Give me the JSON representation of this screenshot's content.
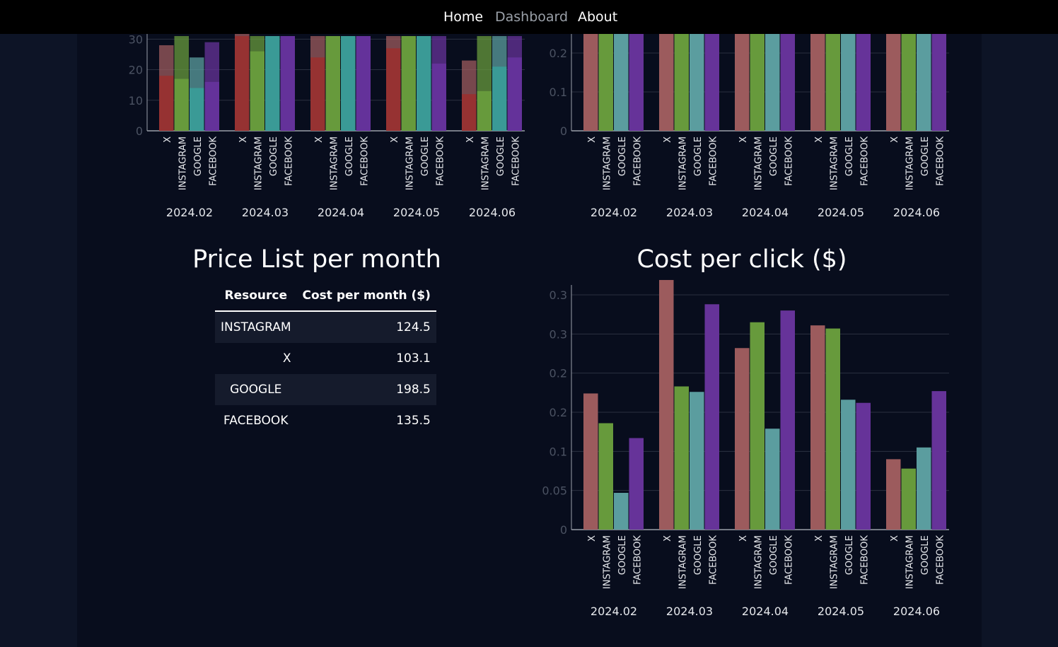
{
  "nav": {
    "home": "Home",
    "dashboard": "Dashboard",
    "about": "About"
  },
  "colors": {
    "X": "#9c5b5d",
    "INSTAGRAM": "#679a3c",
    "GOOGLE": "#5b9d9f",
    "FACEBOOK": "#663399",
    "X_dark": "#963232",
    "INSTAGRAM_dark": "#679a3c",
    "GOOGLE_dark": "#3a9a96",
    "FACEBOOK_dark": "#64329a",
    "grid": "#2a3040",
    "axis_text": "#4b5262"
  },
  "price_list": {
    "title": "Price List per month",
    "headers": [
      "Resource",
      "Cost per month ($)"
    ],
    "rows": [
      {
        "resource": "INSTAGRAM",
        "cost": "124.5"
      },
      {
        "resource": "X",
        "cost": "103.1"
      },
      {
        "resource": "GOOGLE",
        "cost": "198.5"
      },
      {
        "resource": "FACEBOOK",
        "cost": "135.5"
      }
    ]
  },
  "chart_data": [
    {
      "type": "bar",
      "id": "top-left-stacked",
      "title": "",
      "months": [
        "2024.02",
        "2024.03",
        "2024.04",
        "2024.05",
        "2024.06"
      ],
      "resources": [
        "X",
        "INSTAGRAM",
        "GOOGLE",
        "FACEBOOK"
      ],
      "series": [
        {
          "name": "X",
          "values": [
            [
              18,
              28
            ],
            [
              31,
              33
            ],
            [
              24,
              31
            ],
            [
              27,
              31
            ],
            [
              12,
              23
            ]
          ]
        },
        {
          "name": "INSTAGRAM",
          "values": [
            [
              17,
              31
            ],
            [
              26,
              31
            ],
            [
              31,
              31
            ],
            [
              31,
              31
            ],
            [
              13,
              31
            ]
          ]
        },
        {
          "name": "GOOGLE",
          "values": [
            [
              14,
              24
            ],
            [
              31,
              31
            ],
            [
              31,
              31
            ],
            [
              31,
              31
            ],
            [
              21,
              31
            ]
          ]
        },
        {
          "name": "FACEBOOK",
          "values": [
            [
              16,
              29
            ],
            [
              31,
              31
            ],
            [
              31,
              31
            ],
            [
              22,
              31
            ],
            [
              24,
              31
            ]
          ]
        }
      ],
      "value_note": "each pair = [base bar, top bar] heights",
      "yticks": [
        0,
        10,
        20,
        30
      ],
      "ylim": [
        0,
        31
      ]
    },
    {
      "type": "bar",
      "id": "top-right",
      "title": "",
      "months": [
        "2024.02",
        "2024.03",
        "2024.04",
        "2024.05",
        "2024.06"
      ],
      "resources": [
        "X",
        "INSTAGRAM",
        "GOOGLE",
        "FACEBOOK"
      ],
      "series": [
        {
          "name": "X",
          "values": [
            0.25,
            0.25,
            0.25,
            0.25,
            0.25
          ]
        },
        {
          "name": "INSTAGRAM",
          "values": [
            0.25,
            0.25,
            0.25,
            0.25,
            0.25
          ]
        },
        {
          "name": "GOOGLE",
          "values": [
            0.25,
            0.25,
            0.25,
            0.25,
            0.25
          ]
        },
        {
          "name": "FACEBOOK",
          "values": [
            0.25,
            0.25,
            0.25,
            0.25,
            0.25
          ]
        }
      ],
      "yticks": [
        0,
        0.1,
        0.2
      ],
      "ytick_labels": [
        "0",
        "0.1",
        "0.2"
      ],
      "ylim": [
        0,
        0.2
      ]
    },
    {
      "type": "bar",
      "id": "cost-per-click",
      "title": "Cost per click ($)",
      "months": [
        "2024.02",
        "2024.03",
        "2024.04",
        "2024.05",
        "2024.06"
      ],
      "resources": [
        "X",
        "INSTAGRAM",
        "GOOGLE",
        "FACEBOOK"
      ],
      "series": [
        {
          "name": "X",
          "values": [
            0.174,
            0.319,
            0.232,
            0.261,
            0.09
          ]
        },
        {
          "name": "INSTAGRAM",
          "values": [
            0.136,
            0.183,
            0.265,
            0.257,
            0.078
          ]
        },
        {
          "name": "GOOGLE",
          "values": [
            0.047,
            0.176,
            0.129,
            0.166,
            0.105
          ]
        },
        {
          "name": "FACEBOOK",
          "values": [
            0.117,
            0.288,
            0.28,
            0.162,
            0.177
          ]
        }
      ],
      "yticks": [
        0,
        0.05,
        0.1,
        0.15,
        0.2,
        0.25,
        0.3
      ],
      "ytick_labels": [
        "0",
        "0.05",
        "0.1",
        "0.2",
        "0.2",
        "0.3",
        "0.3"
      ],
      "ylim": [
        0,
        0.3
      ]
    }
  ]
}
